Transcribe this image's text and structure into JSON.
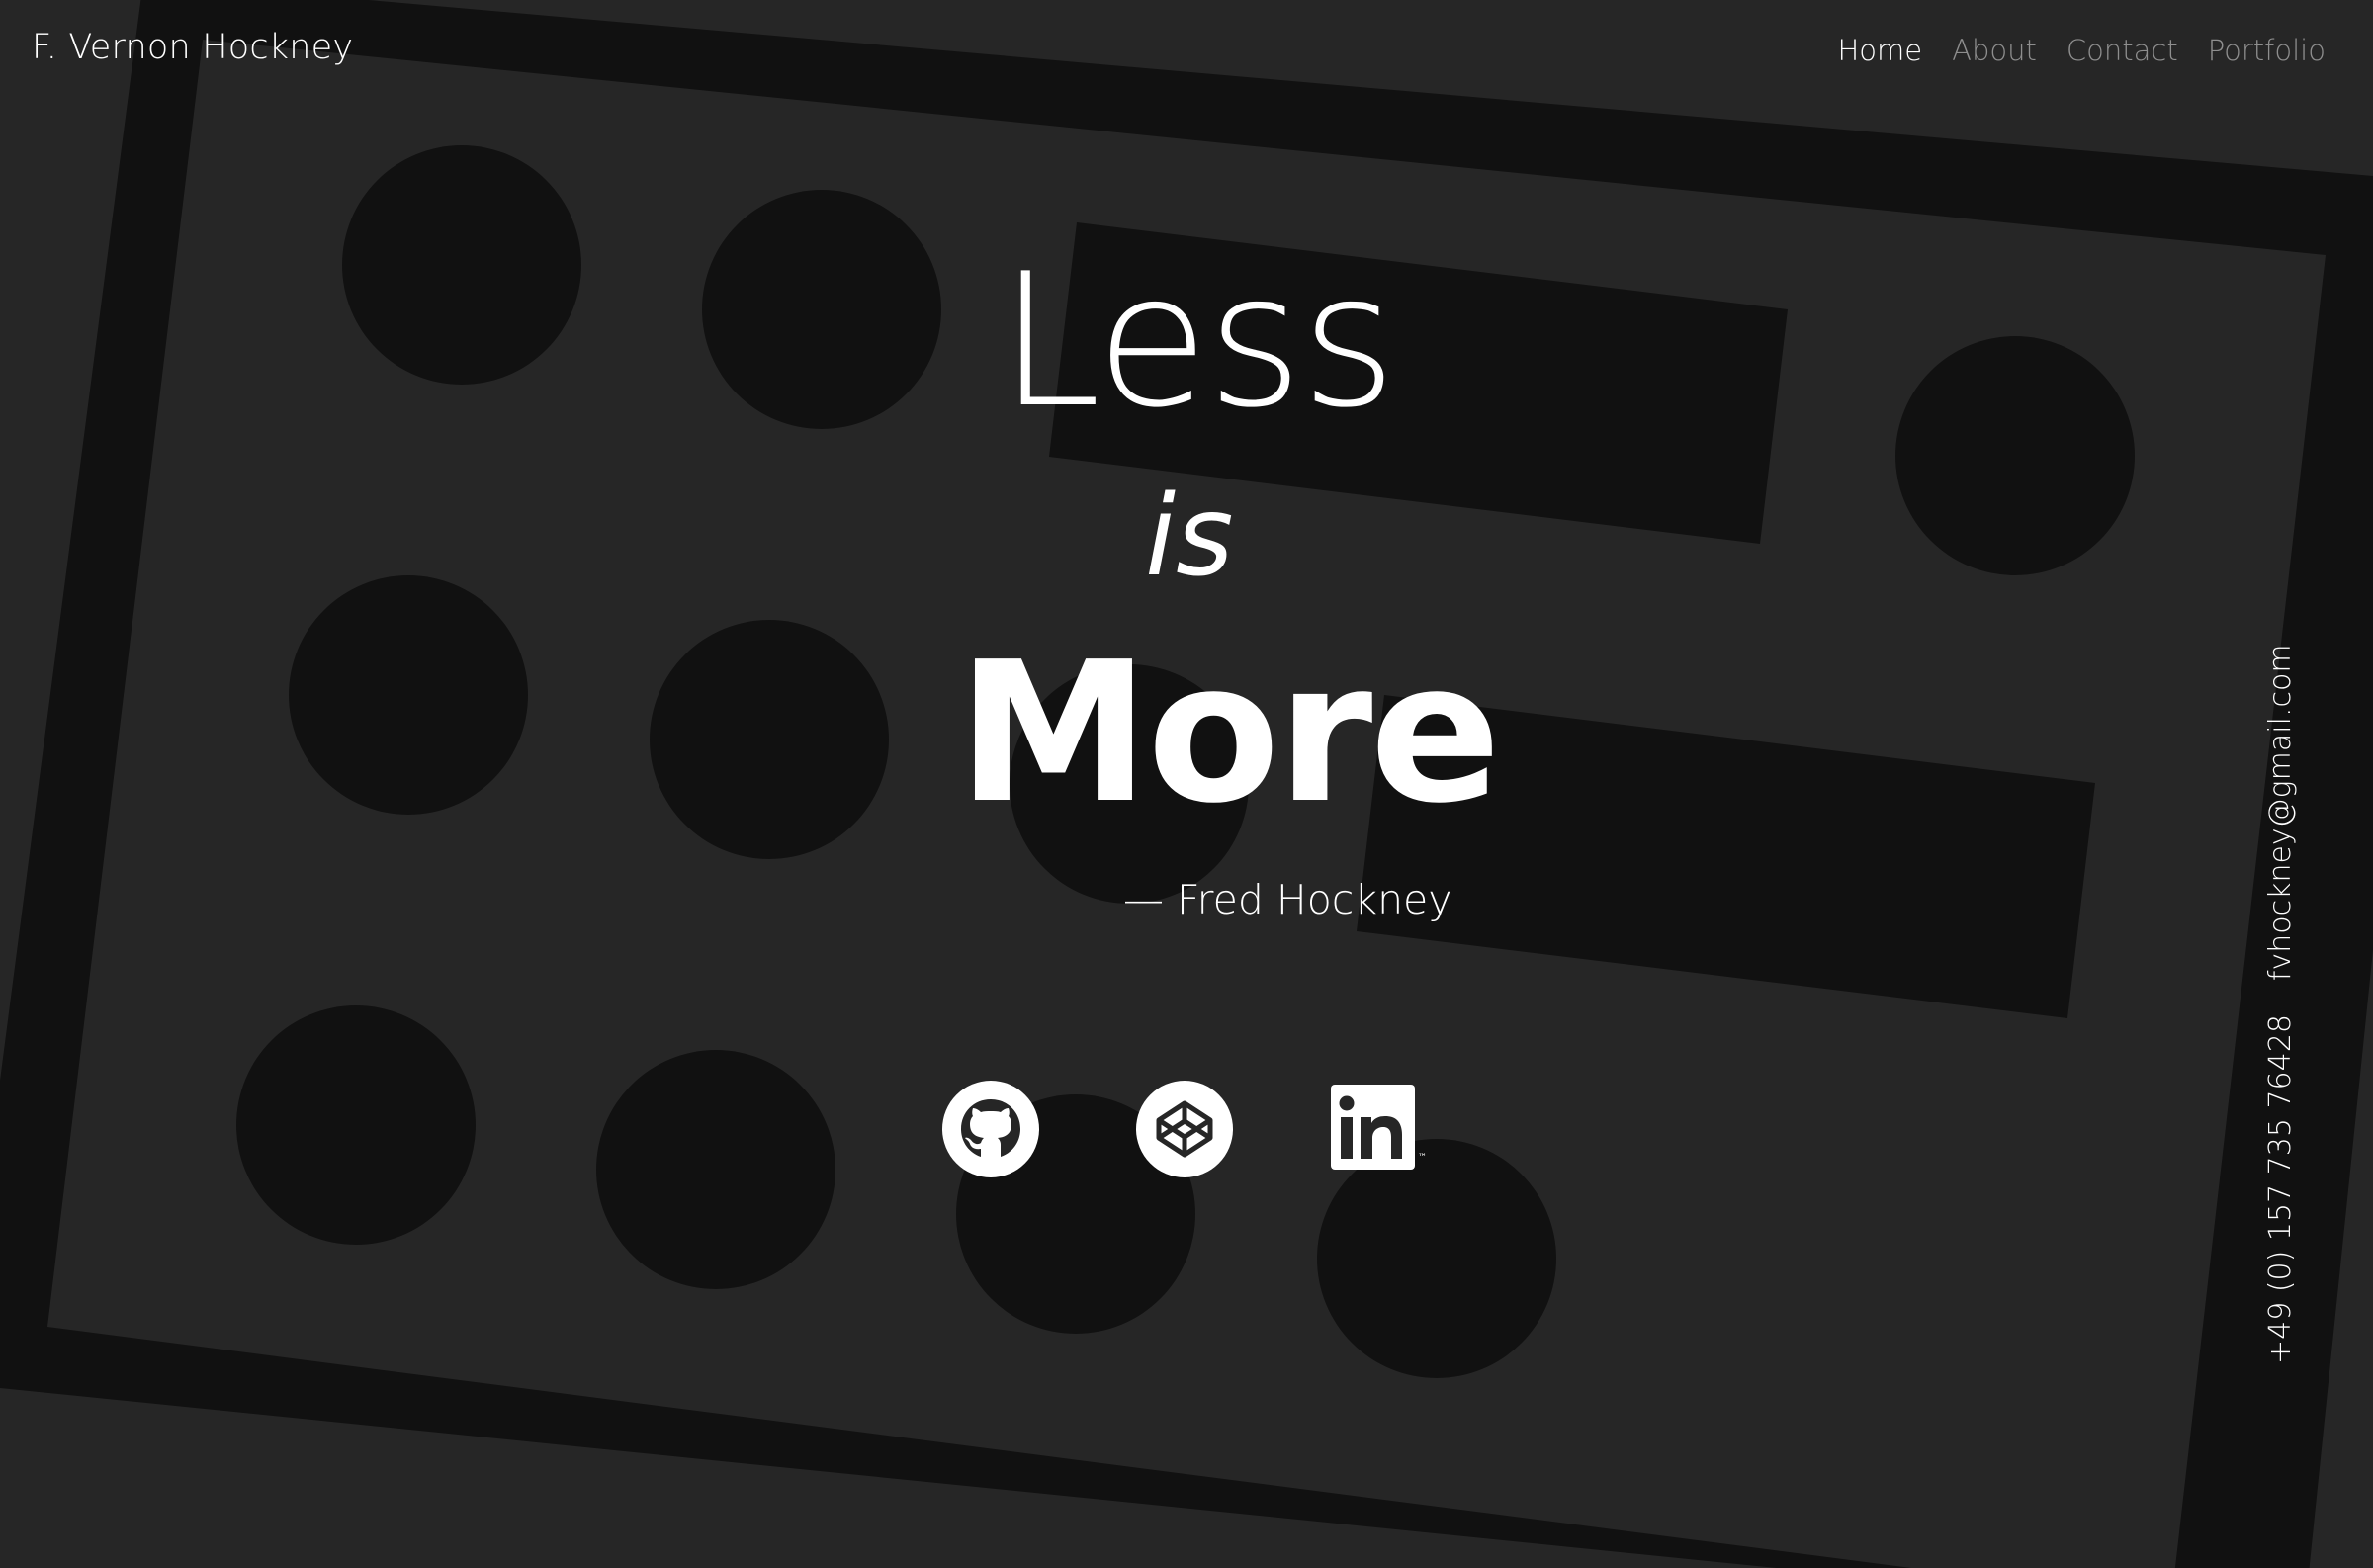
{
  "brand": {
    "name": "F. Vernon Hockney"
  },
  "nav": {
    "items": [
      {
        "label": "Home"
      },
      {
        "label": "About"
      },
      {
        "label": "Contact"
      },
      {
        "label": "Portfolio"
      }
    ]
  },
  "hero": {
    "line1": "Less",
    "line2": "is",
    "line3": "More",
    "author": "— Fred Hockney"
  },
  "social": {
    "items": [
      {
        "icon": "github-icon"
      },
      {
        "icon": "codepen-icon"
      },
      {
        "icon": "linkedin-icon"
      }
    ]
  },
  "contact": {
    "phone": "+49 (0) 157 735 76428",
    "email": "fvhockney@gmail.com"
  },
  "colors": {
    "background": "#262626",
    "shapes": "#111111",
    "text": "#ffffff",
    "nav_inactive": "#8e8e8e"
  }
}
